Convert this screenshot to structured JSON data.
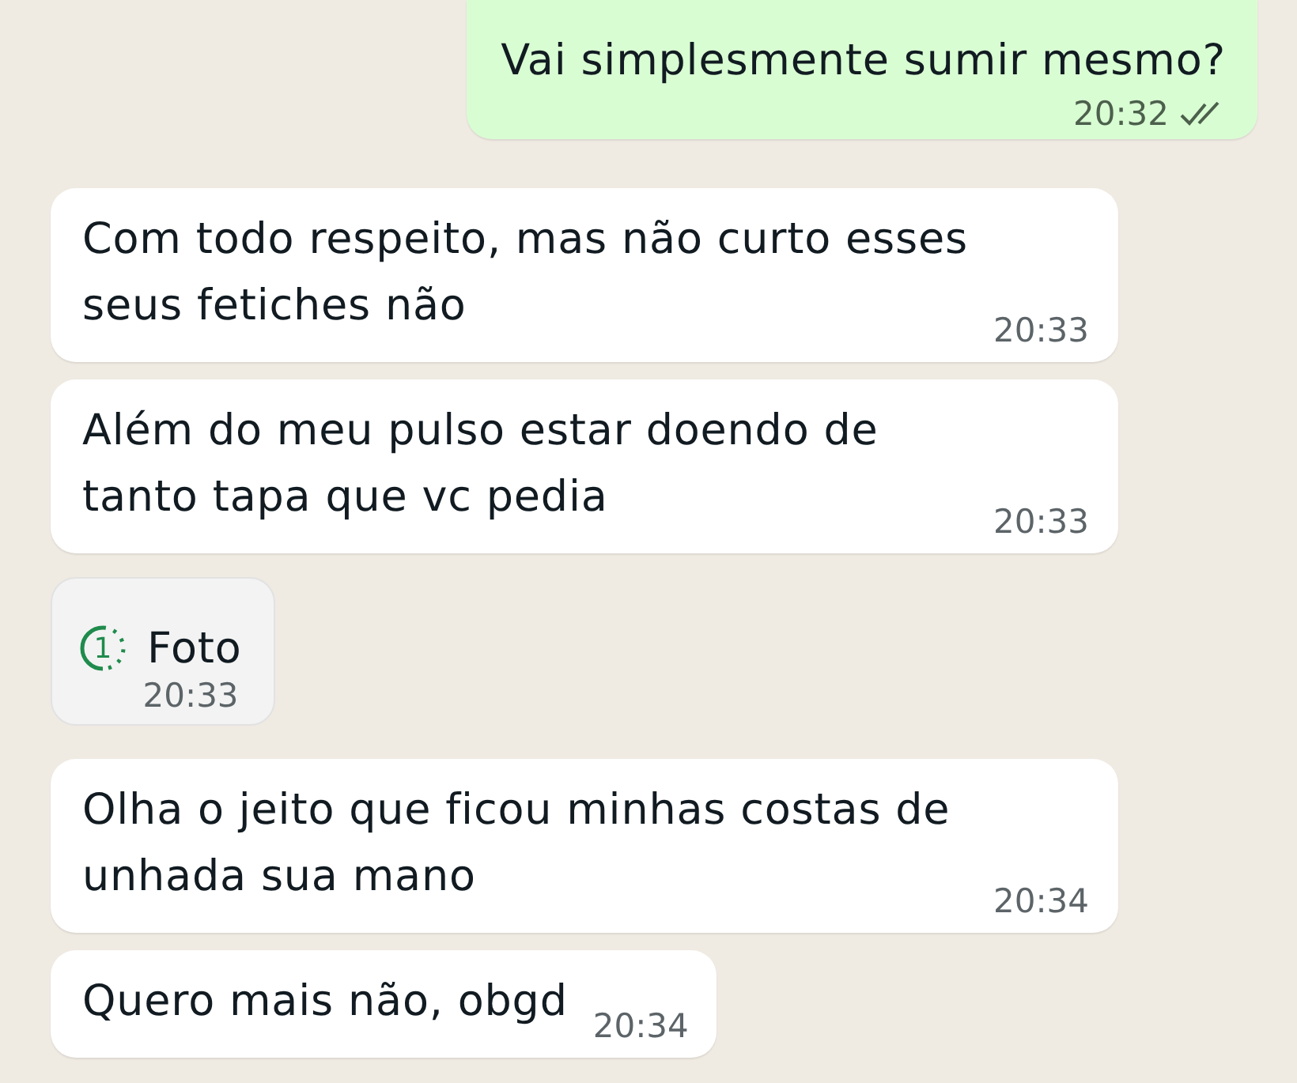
{
  "messages": [
    {
      "kind": "text",
      "outgoing": true,
      "text": "Vai simplesmente sumir mesmo?",
      "time": "20:32",
      "read": false
    },
    {
      "kind": "text",
      "outgoing": false,
      "text": "Com todo respeito, mas não curto esses seus fetiches não",
      "time": "20:33"
    },
    {
      "kind": "text",
      "outgoing": false,
      "text": "Além do meu pulso estar doendo de tanto tapa que vc pedia",
      "time": "20:33"
    },
    {
      "kind": "view_once",
      "outgoing": false,
      "count": "1",
      "text": "Foto",
      "time": "20:33"
    },
    {
      "kind": "text",
      "outgoing": false,
      "text": "Olha o jeito que ficou minhas costas de unhada sua mano",
      "time": "20:34"
    },
    {
      "kind": "text",
      "outgoing": false,
      "text": "Quero mais não, obgd",
      "time": "20:34"
    }
  ]
}
